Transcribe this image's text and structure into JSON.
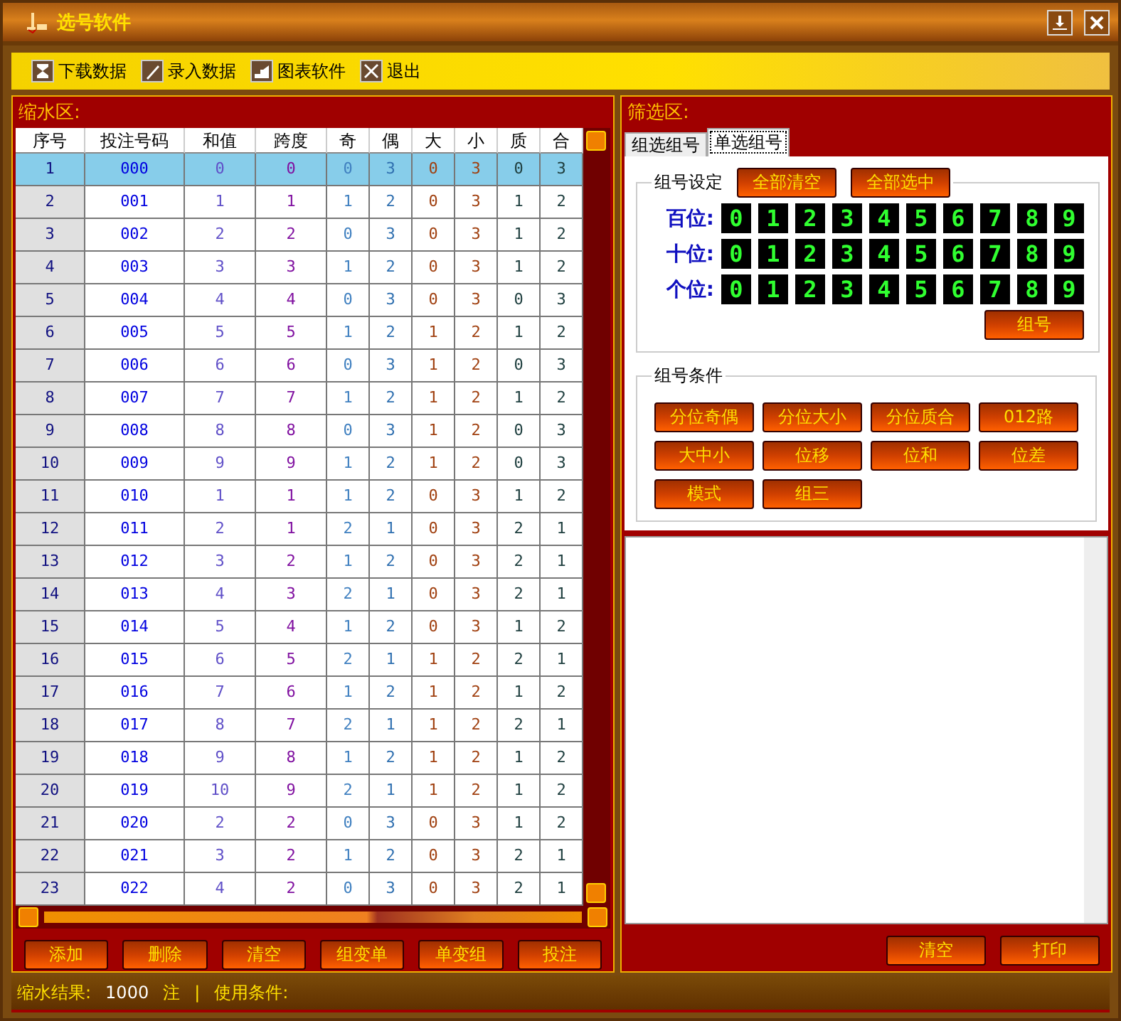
{
  "window": {
    "title": "选号软件"
  },
  "toolbar": [
    {
      "label": "下载数据",
      "kind": "download"
    },
    {
      "label": "录入数据",
      "kind": "pen"
    },
    {
      "label": "图表软件",
      "kind": "chart"
    },
    {
      "label": "退出",
      "kind": "exit"
    }
  ],
  "left_panel": {
    "title": "缩水区:",
    "table": {
      "columns": [
        "序号",
        "投注号码",
        "和值",
        "跨度",
        "奇",
        "偶",
        "大",
        "小",
        "质",
        "合"
      ],
      "rows": [
        {
          "selected": true,
          "cells": [
            "1",
            "000",
            "0",
            "0",
            "0",
            "3",
            "0",
            "3",
            "0",
            "3"
          ]
        },
        {
          "selected": false,
          "cells": [
            "2",
            "001",
            "1",
            "1",
            "1",
            "2",
            "0",
            "3",
            "1",
            "2"
          ]
        },
        {
          "selected": false,
          "cells": [
            "3",
            "002",
            "2",
            "2",
            "0",
            "3",
            "0",
            "3",
            "1",
            "2"
          ]
        },
        {
          "selected": false,
          "cells": [
            "4",
            "003",
            "3",
            "3",
            "1",
            "2",
            "0",
            "3",
            "1",
            "2"
          ]
        },
        {
          "selected": false,
          "cells": [
            "5",
            "004",
            "4",
            "4",
            "0",
            "3",
            "0",
            "3",
            "0",
            "3"
          ]
        },
        {
          "selected": false,
          "cells": [
            "6",
            "005",
            "5",
            "5",
            "1",
            "2",
            "1",
            "2",
            "1",
            "2"
          ]
        },
        {
          "selected": false,
          "cells": [
            "7",
            "006",
            "6",
            "6",
            "0",
            "3",
            "1",
            "2",
            "0",
            "3"
          ]
        },
        {
          "selected": false,
          "cells": [
            "8",
            "007",
            "7",
            "7",
            "1",
            "2",
            "1",
            "2",
            "1",
            "2"
          ]
        },
        {
          "selected": false,
          "cells": [
            "9",
            "008",
            "8",
            "8",
            "0",
            "3",
            "1",
            "2",
            "0",
            "3"
          ]
        },
        {
          "selected": false,
          "cells": [
            "10",
            "009",
            "9",
            "9",
            "1",
            "2",
            "1",
            "2",
            "0",
            "3"
          ]
        },
        {
          "selected": false,
          "cells": [
            "11",
            "010",
            "1",
            "1",
            "1",
            "2",
            "0",
            "3",
            "1",
            "2"
          ]
        },
        {
          "selected": false,
          "cells": [
            "12",
            "011",
            "2",
            "1",
            "2",
            "1",
            "0",
            "3",
            "2",
            "1"
          ]
        },
        {
          "selected": false,
          "cells": [
            "13",
            "012",
            "3",
            "2",
            "1",
            "2",
            "0",
            "3",
            "2",
            "1"
          ]
        },
        {
          "selected": false,
          "cells": [
            "14",
            "013",
            "4",
            "3",
            "2",
            "1",
            "0",
            "3",
            "2",
            "1"
          ]
        },
        {
          "selected": false,
          "cells": [
            "15",
            "014",
            "5",
            "4",
            "1",
            "2",
            "0",
            "3",
            "1",
            "2"
          ]
        },
        {
          "selected": false,
          "cells": [
            "16",
            "015",
            "6",
            "5",
            "2",
            "1",
            "1",
            "2",
            "2",
            "1"
          ]
        },
        {
          "selected": false,
          "cells": [
            "17",
            "016",
            "7",
            "6",
            "1",
            "2",
            "1",
            "2",
            "1",
            "2"
          ]
        },
        {
          "selected": false,
          "cells": [
            "18",
            "017",
            "8",
            "7",
            "2",
            "1",
            "1",
            "2",
            "2",
            "1"
          ]
        },
        {
          "selected": false,
          "cells": [
            "19",
            "018",
            "9",
            "8",
            "1",
            "2",
            "1",
            "2",
            "1",
            "2"
          ]
        },
        {
          "selected": false,
          "cells": [
            "20",
            "019",
            "10",
            "9",
            "2",
            "1",
            "1",
            "2",
            "1",
            "2"
          ]
        },
        {
          "selected": false,
          "cells": [
            "21",
            "020",
            "2",
            "2",
            "0",
            "3",
            "0",
            "3",
            "1",
            "2"
          ]
        },
        {
          "selected": false,
          "cells": [
            "22",
            "021",
            "3",
            "2",
            "1",
            "2",
            "0",
            "3",
            "2",
            "1"
          ]
        },
        {
          "selected": false,
          "cells": [
            "23",
            "022",
            "4",
            "2",
            "0",
            "3",
            "0",
            "3",
            "2",
            "1"
          ]
        }
      ]
    },
    "buttons": [
      "添加",
      "删除",
      "清空",
      "组变单",
      "单变组",
      "投注"
    ]
  },
  "right_panel": {
    "title": "筛选区:",
    "tabs": [
      {
        "label": "组选组号",
        "selected": false
      },
      {
        "label": "单选组号",
        "selected": true
      }
    ],
    "group_setting": {
      "title": "组号设定",
      "buttons": [
        "全部清空",
        "全部选中"
      ],
      "positions": [
        {
          "label": "百位:",
          "digits": [
            "0",
            "1",
            "2",
            "3",
            "4",
            "5",
            "6",
            "7",
            "8",
            "9"
          ]
        },
        {
          "label": "十位:",
          "digits": [
            "0",
            "1",
            "2",
            "3",
            "4",
            "5",
            "6",
            "7",
            "8",
            "9"
          ]
        },
        {
          "label": "个位:",
          "digits": [
            "0",
            "1",
            "2",
            "3",
            "4",
            "5",
            "6",
            "7",
            "8",
            "9"
          ]
        }
      ],
      "action": "组号"
    },
    "conditions": {
      "title": "组号条件",
      "buttons": [
        "分位奇偶",
        "分位大小",
        "分位质合",
        "012路",
        "大中小",
        "位移",
        "位和",
        "位差",
        "模式",
        "组三"
      ]
    },
    "buttons": [
      "清空",
      "打印"
    ]
  },
  "status_bar": {
    "result_label": "缩水结果:",
    "count": "1000",
    "unit": "注",
    "separator": "|",
    "conditions_label": "使用条件:"
  }
}
